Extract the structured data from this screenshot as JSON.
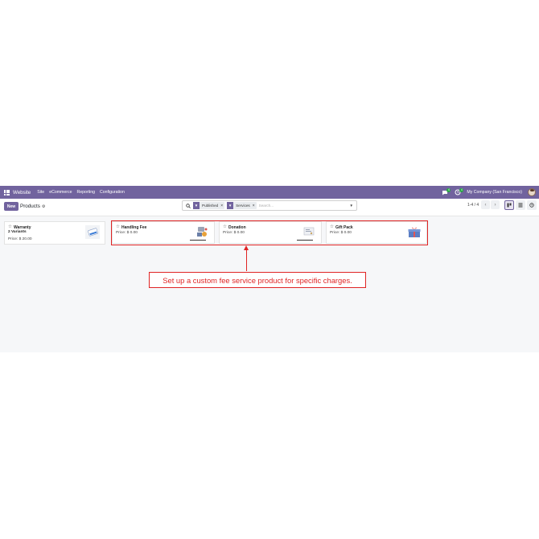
{
  "navbar": {
    "brand": "Website",
    "menu": [
      "Site",
      "eCommerce",
      "Reporting",
      "Configuration"
    ],
    "messages_count": "4",
    "activity_count": "4",
    "company": "My Company (San Francisco)"
  },
  "control": {
    "new_label": "New",
    "title": "Products",
    "facets": [
      {
        "label": "Published"
      },
      {
        "label": "Services"
      }
    ],
    "search_placeholder": "Search...",
    "pager": "1-4 / 4"
  },
  "products": [
    {
      "name": "Warranty",
      "variants": "2 Variants",
      "price": "Price: $ 20.00"
    },
    {
      "name": "Handling Fee",
      "price": "Price: $ 0.00"
    },
    {
      "name": "Donation",
      "price": "Price: $ 0.00"
    },
    {
      "name": "Gift Pack",
      "price": "Price: $ 0.00"
    }
  ],
  "annotation": {
    "text": "Set up a custom fee service product for specific charges."
  },
  "colors": {
    "brand": "#71639e",
    "highlight": "#e02424",
    "background": "#f6f7f9"
  }
}
